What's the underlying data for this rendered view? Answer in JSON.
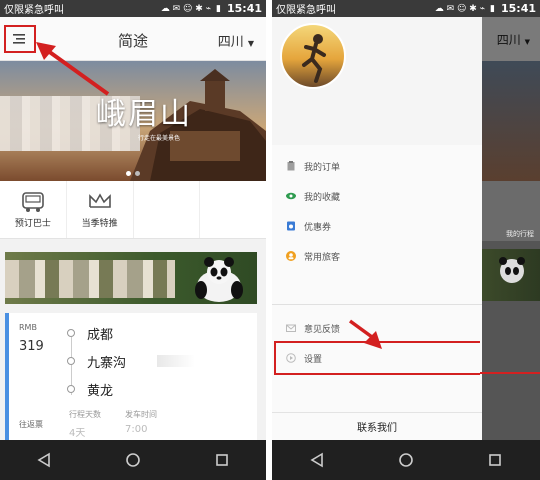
{
  "status_bar": {
    "carrier": "仅限紧急呼叫",
    "time": "15:41"
  },
  "left_screen": {
    "header": {
      "title": "简途",
      "city": "四川"
    },
    "banner": {
      "title": "峨眉山",
      "subtitle": "行走在最美景色"
    },
    "quick_nav": [
      {
        "label": "预订巴士",
        "icon": "bus-icon"
      },
      {
        "label": "当季特推",
        "icon": "crown-icon"
      }
    ],
    "route": {
      "currency": "RMB",
      "price": "319",
      "stops": [
        "成都",
        "九寨沟",
        "黄龙"
      ],
      "trip_type": "往返票",
      "days_label": "行程天数",
      "days_value": "4天",
      "departure_label": "发车时间",
      "departure_value": "7:00"
    }
  },
  "right_screen": {
    "city": "四川",
    "behind_label": "我的行程",
    "menu": [
      {
        "label": "我的订单",
        "icon": "clipboard-icon",
        "color": "#9e9e9e"
      },
      {
        "label": "我的收藏",
        "icon": "eye-icon",
        "color": "#2e9b4f"
      },
      {
        "label": "优惠券",
        "icon": "coupon-icon",
        "color": "#3a7bd5"
      },
      {
        "label": "常用旅客",
        "icon": "user-icon",
        "color": "#f0a020"
      }
    ],
    "menu2": [
      {
        "label": "意见反馈",
        "icon": "mail-icon",
        "color": "#bbbbbb"
      },
      {
        "label": "设置",
        "icon": "settings-icon",
        "color": "#bbbbbb"
      }
    ],
    "contact": "联系我们"
  },
  "colors": {
    "annotation_red": "#d32020",
    "accent_blue": "#4a90e2"
  }
}
